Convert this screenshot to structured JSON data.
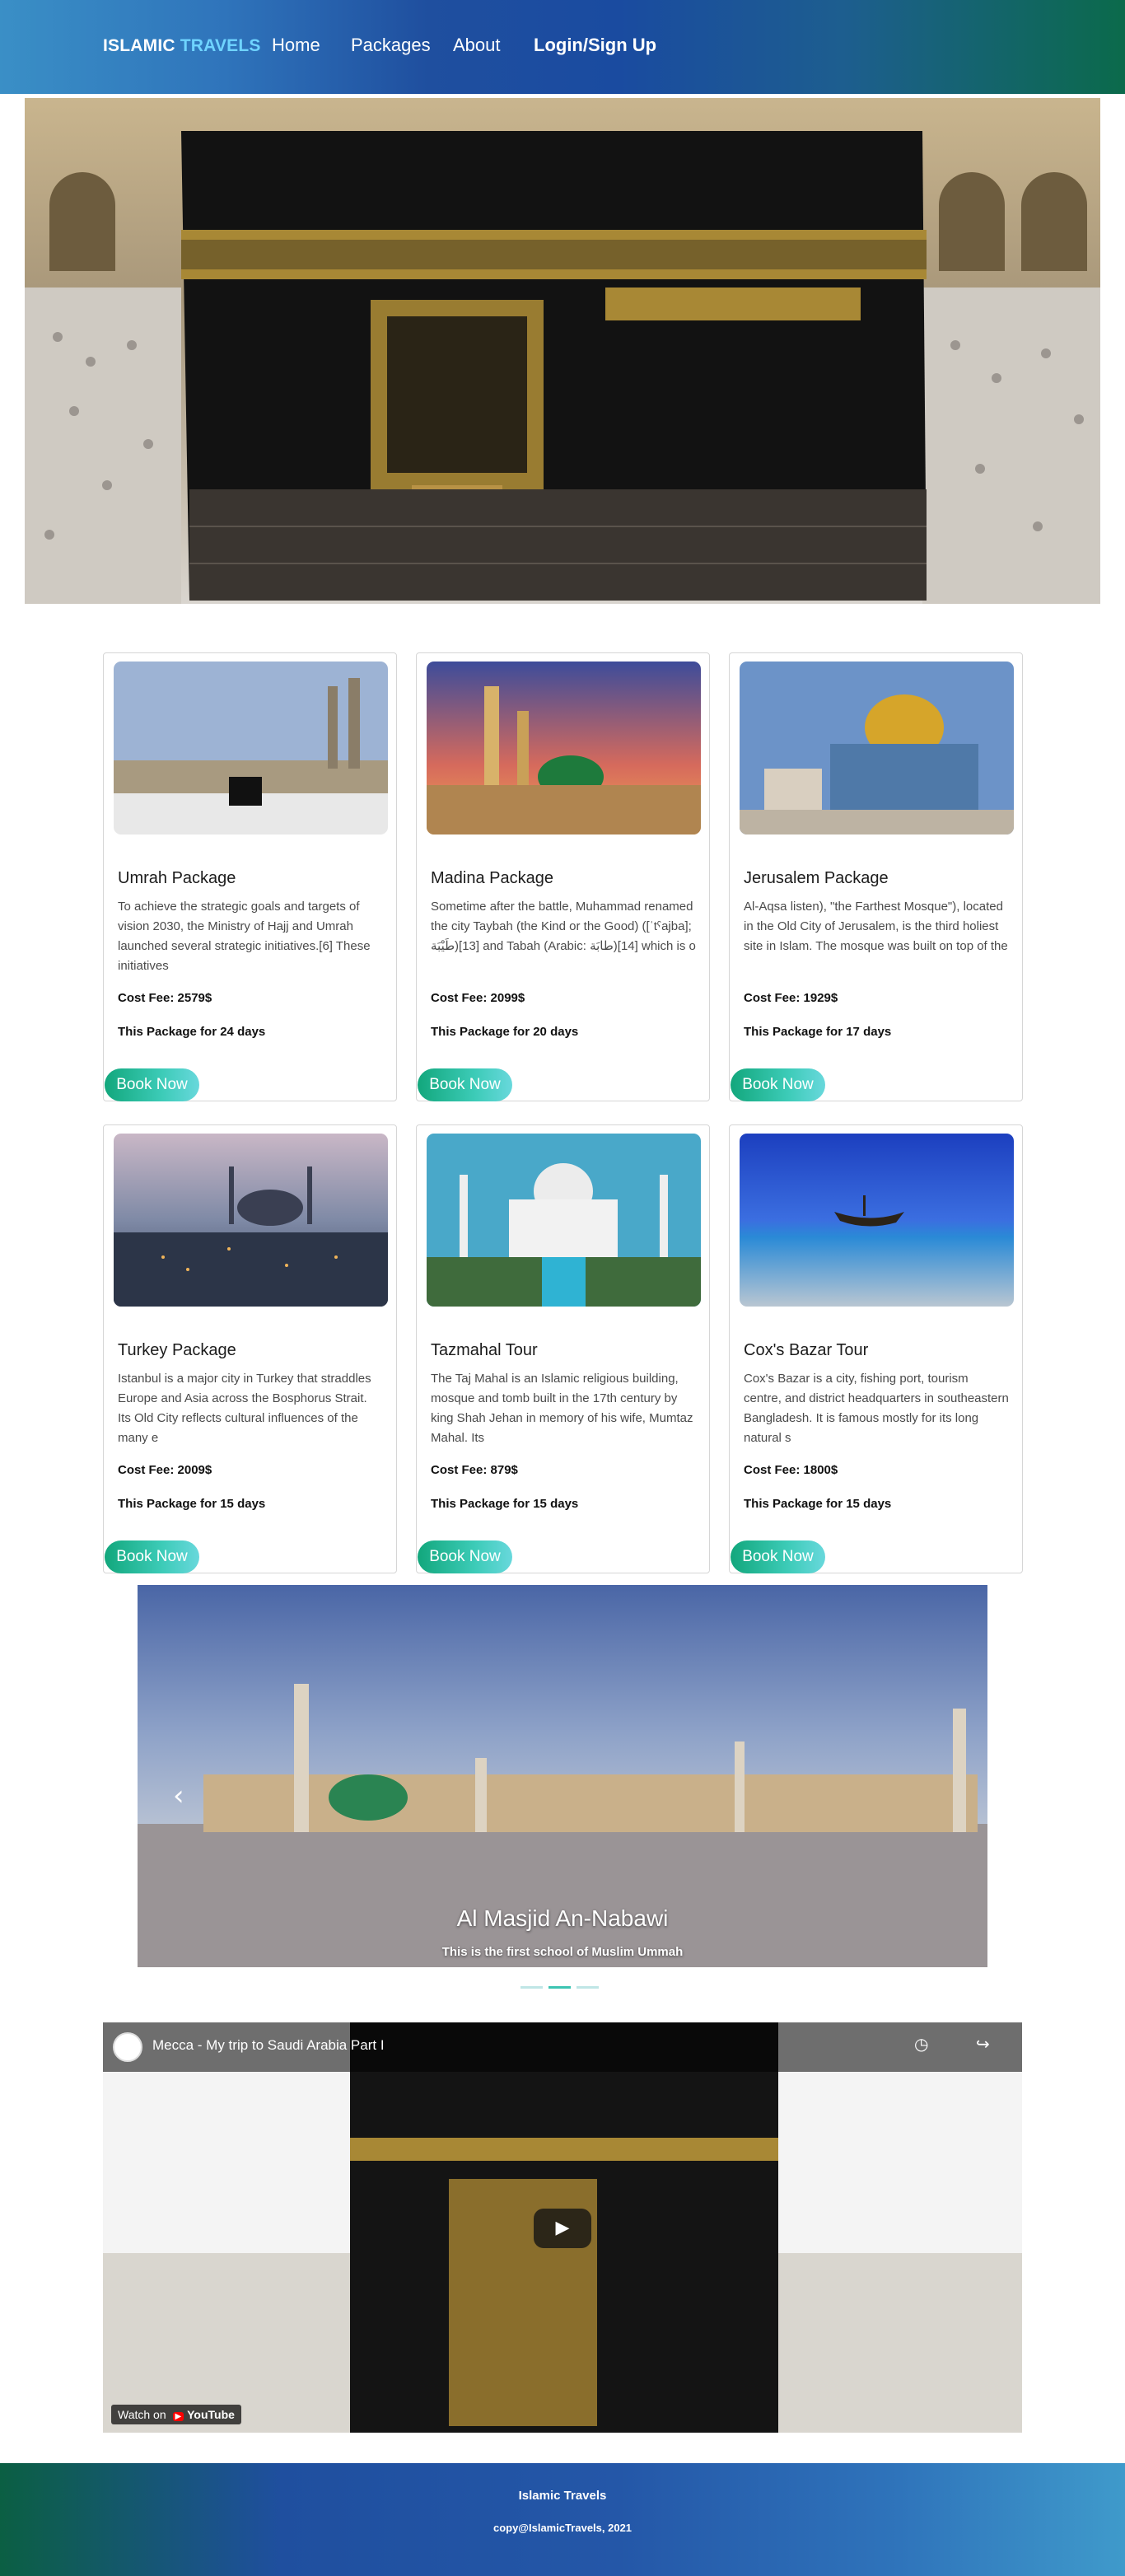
{
  "nav": {
    "brand_main": "ISLAMIC ",
    "brand_accent": "TRAVELS",
    "links": [
      "Home",
      "Packages",
      "About"
    ],
    "login": "Login/Sign Up"
  },
  "hero": {
    "image": "kaaba-photo"
  },
  "packages": [
    {
      "title": "Umrah Package",
      "desc": "To achieve the strategic goals and targets of vision 2030, the Ministry of Hajj and Umrah launched several strategic initiatives.[6] These initiatives",
      "cost": "Cost Fee: 2579$",
      "days": "This Package for 24 days",
      "button": "Book Now",
      "image": "masjid-al-haram-photo"
    },
    {
      "title": "Madina Package",
      "desc": "Sometime after the battle, Muhammad renamed the city Taybah (the Kind or the Good) ([ˈtˤajba]; طَيْبَة)[13] and Tabah (Arabic: طابَة)[14] which is o",
      "cost": "Cost Fee: 2099$",
      "days": "This Package for 20 days",
      "button": "Book Now",
      "image": "green-dome-photo"
    },
    {
      "title": "Jerusalem Package",
      "desc": "Al-Aqsa listen), \"the Farthest Mosque\"), located in the Old City of Jerusalem, is the third holiest site in Islam. The mosque was built on top of the",
      "cost": "Cost Fee: 1929$",
      "days": "This Package for 17 days",
      "button": "Book Now",
      "image": "dome-of-the-rock-photo"
    },
    {
      "title": "Turkey Package",
      "desc": "Istanbul is a major city in Turkey that straddles Europe and Asia across the Bosphorus Strait. Its Old City reflects cultural influences of the many e",
      "cost": "Cost Fee: 2009$",
      "days": "This Package for 15 days",
      "button": "Book Now",
      "image": "istanbul-photo"
    },
    {
      "title": "Tazmahal Tour",
      "desc": "The Taj Mahal is an Islamic religious building, mosque and tomb built in the 17th century by king Shah Jehan in memory of his wife, Mumtaz Mahal. Its",
      "cost": "Cost Fee: 879$",
      "days": "This Package for 15 days",
      "button": "Book Now",
      "image": "taj-mahal-photo"
    },
    {
      "title": "Cox's Bazar Tour",
      "desc": "Cox's Bazar is a city, fishing port, tourism centre, and district headquarters in southeastern Bangladesh. It is famous mostly for its long natural s",
      "cost": "Cost Fee: 1800$",
      "days": "This Package for 15 days",
      "button": "Book Now",
      "image": "beach-boat-photo"
    }
  ],
  "carousel": {
    "caption": "Al Masjid An-Nabawi",
    "subcaption": "This is the first school of Muslim Ummah",
    "prev_icon": "‹",
    "active_dot": 1
  },
  "video": {
    "title": "Mecca - My trip to Saudi Arabia Part I",
    "watch_on": "Watch on",
    "brand": "YouTube"
  },
  "footer": {
    "title": "Islamic Travels",
    "copy": "copy@IslamicTravels, 2021"
  },
  "colors": {
    "accent": "#6fd4ff",
    "button_start": "#12a77c",
    "button_end": "#68d8dc"
  }
}
